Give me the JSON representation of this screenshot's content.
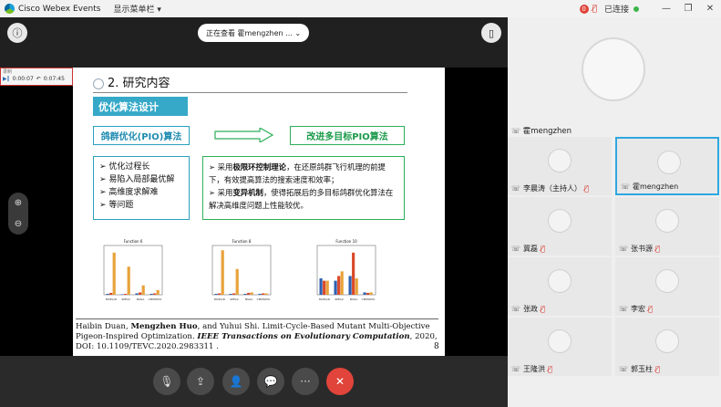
{
  "titlebar": {
    "app": "Cisco Webex Events",
    "menu": "显示菜单栏 ▾",
    "badge": "0",
    "status": "已连接",
    "icons": [
      "cisco-logo",
      "mic-muted-icon",
      "minimize-icon",
      "restore-icon",
      "close-icon"
    ],
    "min": "—",
    "restore": "❐",
    "close": "✕"
  },
  "topbar": {
    "viewing": "正在查看 霍mengzhen ... ⌄",
    "info_icon": "ⓘ",
    "panel_icon": "▯"
  },
  "recorder": {
    "label": "录制",
    "time1": "0:00:07",
    "time2": "0:07:45"
  },
  "slide": {
    "section": "2.  研究内容",
    "opt_title": "优化算法设计",
    "pio": "鸽群优化(PIO)算法",
    "improved": "改进多目标PIO算法",
    "left_items": [
      "➢ 优化过程长",
      "➢ 易陷入局部最优解",
      "➢ 高维度求解难",
      "➢ 等问题"
    ],
    "right_items": [
      {
        "pre": "➢ 采用",
        "bold": "极限环控制理论",
        "post": "，在还原鸽群飞行机理的前提下，有效提高算法的搜索速度和效率；"
      },
      {
        "pre": "➢ 采用",
        "bold": "变异机制",
        "post": "，使得拓展后的多目标鸽群优化算法在解决高维度问题上性能较优。"
      }
    ],
    "citation": {
      "l1a": "Haibin Duan, ",
      "l1b": "Mengzhen Huo",
      "l1c": ", and Yuhui Shi. Limit-Cycle-Based Mutant Multi-Objective",
      "l2a": "Pigeon-Inspired Optimization. ",
      "l2b": "IEEE Transactions on Evolutionary Computation",
      "l2c": ", 2020,",
      "l3": "DOI: 10.1109/TEVC.2020.2983311 ."
    },
    "page": "8",
    "chart_titles": [
      "Function 6",
      "Function 8",
      "Function 10"
    ]
  },
  "chart_data": [
    {
      "type": "bar",
      "title": "Function 6",
      "categories": [
        "MOEA/D",
        "SPEA2",
        "NSGA",
        "CMMOPIO"
      ],
      "series": [
        {
          "color": "#2f5fb0",
          "values": [
            0.02,
            0.01,
            0.03,
            0.02
          ]
        },
        {
          "color": "#d94a2a",
          "values": [
            0.04,
            0.02,
            0.05,
            0.03
          ]
        },
        {
          "color": "#e8a23a",
          "values": [
            0.9,
            0.6,
            0.2,
            0.1
          ]
        }
      ]
    },
    {
      "type": "bar",
      "title": "Function 8",
      "categories": [
        "MOEA/D",
        "SPEA2",
        "NSGA",
        "CMMOPIO"
      ],
      "series": [
        {
          "color": "#2f5fb0",
          "values": [
            0.02,
            0.02,
            0.02,
            0.02
          ]
        },
        {
          "color": "#d94a2a",
          "values": [
            0.03,
            0.03,
            0.04,
            0.03
          ]
        },
        {
          "color": "#e8a23a",
          "values": [
            0.95,
            0.55,
            0.05,
            0.03
          ]
        }
      ]
    },
    {
      "type": "bar",
      "title": "Function 10",
      "categories": [
        "MOEA/D",
        "SPEA2",
        "NSGA",
        "CMMOPIO"
      ],
      "series": [
        {
          "color": "#2f5fb0",
          "values": [
            0.35,
            0.3,
            0.4,
            0.05
          ]
        },
        {
          "color": "#d94a2a",
          "values": [
            0.3,
            0.4,
            0.9,
            0.04
          ]
        },
        {
          "color": "#e8a23a",
          "values": [
            0.3,
            0.5,
            0.35,
            0.05
          ]
        }
      ]
    }
  ],
  "panel": {
    "main_name": "霍mengzhen",
    "tiles": [
      {
        "name": "李晨涛（主持人）",
        "muted": true
      },
      {
        "name": "霍mengzhen",
        "muted": false
      },
      {
        "name": "冀磊",
        "muted": true
      },
      {
        "name": "张书源",
        "muted": true
      },
      {
        "name": "张政",
        "muted": true
      },
      {
        "name": "李宏",
        "muted": true
      },
      {
        "name": "王隆洪",
        "muted": true
      },
      {
        "name": "郭玉柱",
        "muted": true
      }
    ]
  },
  "bottom": {
    "mute": "🎙",
    "share": "⇪",
    "participants": "👤",
    "chat": "💬",
    "more": "···",
    "end": "✕"
  }
}
